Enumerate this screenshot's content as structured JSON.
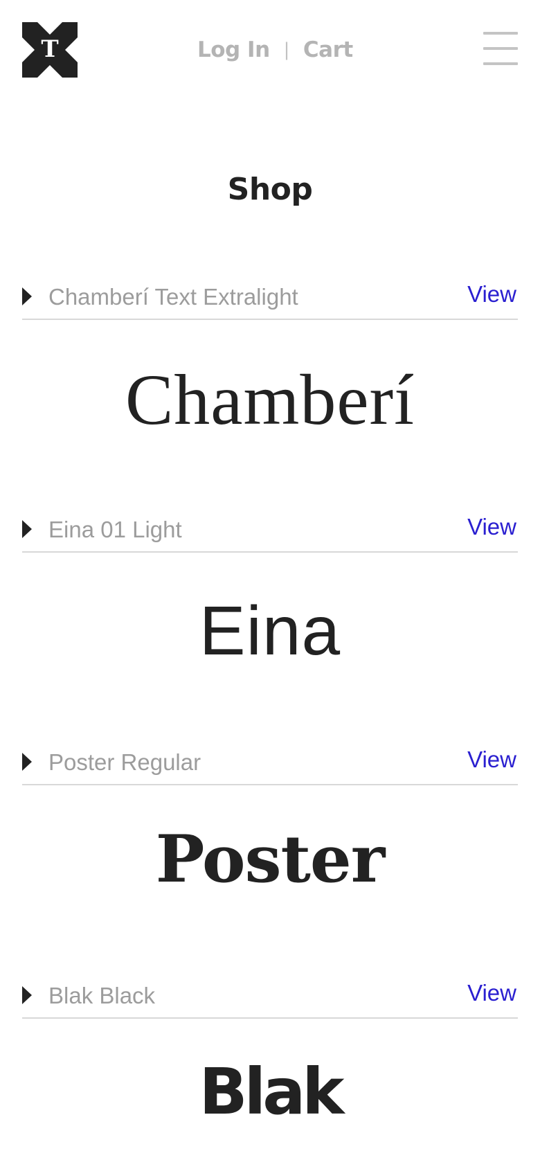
{
  "header": {
    "logo_letter": "T",
    "login_label": "Log In",
    "separator": "|",
    "cart_label": "Cart"
  },
  "page": {
    "title": "Shop"
  },
  "products": [
    {
      "name": "Chamberí Text Extralight",
      "view_label": "View",
      "specimen": "Chamberí"
    },
    {
      "name": "Eina 01 Light",
      "view_label": "View",
      "specimen": "Eina"
    },
    {
      "name": "Poster Regular",
      "view_label": "View",
      "specimen": "Poster"
    },
    {
      "name": "Blak Black",
      "view_label": "View",
      "specimen": "Blak"
    }
  ],
  "colors": {
    "text": "#222222",
    "muted": "#9c9c9c",
    "nav": "#b4b4b4",
    "link": "#2a1fd0",
    "divider": "#d8d8d8"
  },
  "icons": {
    "menu": "hamburger-menu-icon",
    "expand": "triangle-right-icon",
    "logo": "x-t-logo"
  }
}
